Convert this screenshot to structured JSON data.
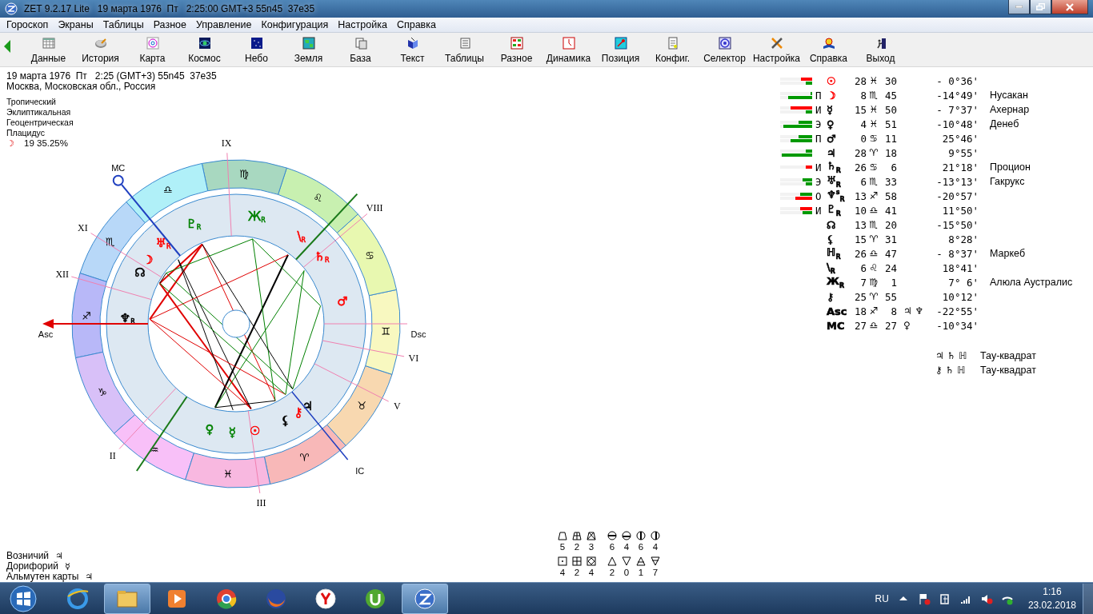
{
  "window": {
    "title": "ZET 9.2.17 Lite   19 марта 1976  Пт   2:25:00 GMT+3 55n45  37e35"
  },
  "menu": [
    "Гороскоп",
    "Экраны",
    "Таблицы",
    "Разное",
    "Управление",
    "Конфигурация",
    "Настройка",
    "Справка"
  ],
  "toolbar": [
    "Данные",
    "История",
    "Карта",
    "Космос",
    "Небо",
    "Земля",
    "База",
    "Текст",
    "Таблицы",
    "Разное",
    "Динамика",
    "Позиция",
    "Конфиг.",
    "Селектор",
    "Настройка",
    "Справка",
    "Выход"
  ],
  "info": {
    "lines": [
      "19 марта 1976  Пт   2:25 (GMT+3) 55n45  37e35",
      "Москва, Московская обл., Россия"
    ],
    "settings": [
      "Тропический",
      "Эклиптикальная",
      "Геоцентрическая",
      "Плацидус"
    ],
    "moon_phase": {
      "glyph": "☽",
      "text": "19 35.25%"
    }
  },
  "wheel": {
    "signs": [
      {
        "glyph": "♈",
        "color": "#f8b8b8"
      },
      {
        "glyph": "♉",
        "color": "#f8d8b0"
      },
      {
        "glyph": "♊",
        "color": "#f8f8c0"
      },
      {
        "glyph": "♋",
        "color": "#e8f8b0"
      },
      {
        "glyph": "♌",
        "color": "#c8f0b0"
      },
      {
        "glyph": "♍",
        "color": "#a8d8c0"
      },
      {
        "glyph": "♎",
        "color": "#b0f0f8"
      },
      {
        "glyph": "♏",
        "color": "#b8d8f8"
      },
      {
        "glyph": "♐",
        "color": "#b8b8f8"
      },
      {
        "glyph": "♑",
        "color": "#d8c0f8"
      },
      {
        "glyph": "♒",
        "color": "#f8c0f8"
      },
      {
        "glyph": "♓",
        "color": "#f8b8e0"
      }
    ],
    "houses": [
      "IX",
      "VIII",
      "XI",
      "XII",
      "II",
      "III",
      "V",
      "VI"
    ],
    "axes": [
      {
        "kind": "asc",
        "label": "Asc"
      },
      {
        "kind": "mc",
        "label": "MC"
      },
      {
        "kind": "dsc",
        "label": "Dsc"
      },
      {
        "kind": "ic",
        "label": "IC"
      }
    ],
    "planets": [
      {
        "glyph": "Ж",
        "sub": "R",
        "color": "#008000"
      },
      {
        "glyph": "♇",
        "sub": "R",
        "color": "#008000"
      },
      {
        "glyph": "♅",
        "sub": "R",
        "color": "#ff0000"
      },
      {
        "glyph": "\\",
        "sub": "R",
        "color": "#ff0000"
      },
      {
        "glyph": "☽",
        "color": "#ff0000"
      },
      {
        "glyph": "♄",
        "sub": "R",
        "color": "#ff0000"
      },
      {
        "glyph": "☊",
        "color": "#000000"
      },
      {
        "glyph": "♂",
        "color": "#ff0000"
      },
      {
        "glyph": "♆",
        "sub": "R",
        "color": "#000000"
      },
      {
        "glyph": "♀",
        "color": "#008000"
      },
      {
        "glyph": "☿",
        "color": "#008000"
      },
      {
        "glyph": "☉",
        "color": "#ff0000"
      },
      {
        "glyph": "⚸",
        "color": "#000000"
      },
      {
        "glyph": "⚷",
        "color": "#ff0000"
      },
      {
        "glyph": "♃",
        "color": "#000000"
      }
    ]
  },
  "table": {
    "rows": [
      {
        "bars": [
          {
            "color": "#ff0000",
            "level": 0.36
          },
          {
            "color": "#009900",
            "level": 0.2
          }
        ],
        "glyph": "☉",
        "color": "#ff0000",
        "deg": "28",
        "sign": "♓",
        "min": "30",
        "decl": "- 0°36'"
      },
      {
        "bars": [
          {
            "color": "#009900",
            "level": 0.06
          },
          {
            "color": "#009900",
            "level": 0.75
          }
        ],
        "letter": "П",
        "glyph": "☽",
        "color": "#ff0000",
        "deg": "8",
        "sign": "♏",
        "min": "45",
        "decl": "-14°49'",
        "star": "Нусакан"
      },
      {
        "bars": [
          {
            "color": "#ff0000",
            "level": 0.67
          },
          {
            "color": "#009900",
            "level": 0.2
          }
        ],
        "letter": "И",
        "glyph": "☿",
        "color": "#000000",
        "deg": "15",
        "sign": "♓",
        "min": "50",
        "decl": "- 7°37'",
        "star": "Ахернар"
      },
      {
        "bars": [
          {
            "color": "#009900",
            "level": 0.42
          },
          {
            "color": "#009900",
            "level": 0.9
          }
        ],
        "letter": "Э",
        "glyph": "♀",
        "color": "#000000",
        "deg": "4",
        "sign": "♓",
        "min": "51",
        "decl": "-10°48'",
        "star": "Денеб"
      },
      {
        "bars": [
          {
            "color": "#009900",
            "level": 0.42
          },
          {
            "color": "#009900",
            "level": 0.67
          }
        ],
        "letter": "П",
        "glyph": "♂",
        "color": "#000000",
        "deg": "0",
        "sign": "♋",
        "min": "11",
        "decl": "25°46'"
      },
      {
        "bars": [
          {
            "color": "#009900",
            "level": 0.2
          },
          {
            "color": "#009900",
            "level": 0.96
          }
        ],
        "glyph": "♃",
        "color": "#000000",
        "deg": "28",
        "sign": "♈",
        "min": "18",
        "decl": "9°55'"
      },
      {
        "bars": [
          {
            "color": "#ff0000",
            "level": 0.2
          }
        ],
        "letter": "И",
        "glyph": "♄",
        "sub": "R",
        "color": "#000000",
        "deg": "26",
        "sign": "♋",
        "min": "6",
        "decl": "21°18'",
        "star": "Процион"
      },
      {
        "bars": [
          {
            "color": "#009900",
            "level": 0.3
          },
          {
            "color": "#009900",
            "level": 0.2
          }
        ],
        "letter": "Э",
        "glyph": "♅",
        "sub": "R",
        "color": "#000000",
        "deg": "6",
        "sign": "♏",
        "min": "33",
        "decl": "-13°13'",
        "star": "Гакрукс"
      },
      {
        "bars": [
          {
            "color": "#009900",
            "level": 0.38
          },
          {
            "color": "#ff0000",
            "level": 0.52
          }
        ],
        "letter": "О",
        "glyph": "♆",
        "sup": "s",
        "sub": "R",
        "color": "#000000",
        "deg": "13",
        "sign": "♐",
        "min": "58",
        "decl": "-20°57'"
      },
      {
        "bars": [
          {
            "color": "#ff0000",
            "level": 0.38
          },
          {
            "color": "#009900",
            "level": 0.3
          }
        ],
        "letter": "И",
        "glyph": "♇",
        "sub": "R",
        "color": "#000000",
        "deg": "10",
        "sign": "♎",
        "min": "41",
        "decl": "11°50'"
      },
      {
        "glyph": "☊",
        "color": "#000000",
        "deg": "13",
        "sign": "♏",
        "min": "20",
        "decl": "-15°50'"
      },
      {
        "glyph": "⚸",
        "color": "#000000",
        "deg": "15",
        "sign": "♈",
        "min": "31",
        "decl": "8°28'"
      },
      {
        "glyph": "ℍ",
        "sub": "R",
        "color": "#000000",
        "deg": "26",
        "sign": "♎",
        "min": "47",
        "decl": "- 8°37'",
        "star": "Маркеб"
      },
      {
        "glyph": "\\",
        "sub": "R",
        "color": "#000000",
        "deg": "6",
        "sign": "♌",
        "min": "24",
        "decl": "18°41'"
      },
      {
        "glyph": "Ж",
        "sub": "R",
        "color": "#000000",
        "deg": "7",
        "sign": "♍",
        "min": "1",
        "decl": "7° 6'",
        "star": "Алюла Аустралис"
      },
      {
        "glyph": "⚷",
        "color": "#000000",
        "deg": "25",
        "sign": "♈",
        "min": "55",
        "decl": "10°12'"
      },
      {
        "glyph": "Asc",
        "color": "#000000",
        "deg": "18",
        "sign": "♐",
        "min": "8",
        "aspect": "♃ ♆",
        "decl": "-22°55'"
      },
      {
        "glyph": "MC",
        "color": "#000000",
        "deg": "27",
        "sign": "♎",
        "min": "27",
        "aspect": "♀",
        "decl": "-10°34'"
      }
    ],
    "configurations": [
      {
        "glyphs": "♃ ♄ ℍ",
        "name": "Тау-квадрат"
      },
      {
        "glyphs": "⚷ ♄ ℍ",
        "name": "Тау-квадрат"
      }
    ]
  },
  "rulers": [
    {
      "label": "Возничий",
      "glyph": "♃"
    },
    {
      "label": "Дорифорий",
      "glyph": "☿"
    },
    {
      "label": "Альмутен карты",
      "glyph": "♃"
    }
  ],
  "counts": [
    {
      "kind": "crosses",
      "values": [
        "5",
        "2",
        "3"
      ]
    },
    {
      "kind": "halves",
      "values": [
        "6",
        "4",
        "6",
        "4"
      ]
    },
    {
      "kind": "squares",
      "values": [
        "4",
        "2",
        "4"
      ]
    },
    {
      "kind": "triangles",
      "values": [
        "2",
        "0",
        "1",
        "7"
      ]
    }
  ],
  "taskbar": {
    "language": "RU",
    "time": "1:16",
    "date": "23.02.2018"
  }
}
